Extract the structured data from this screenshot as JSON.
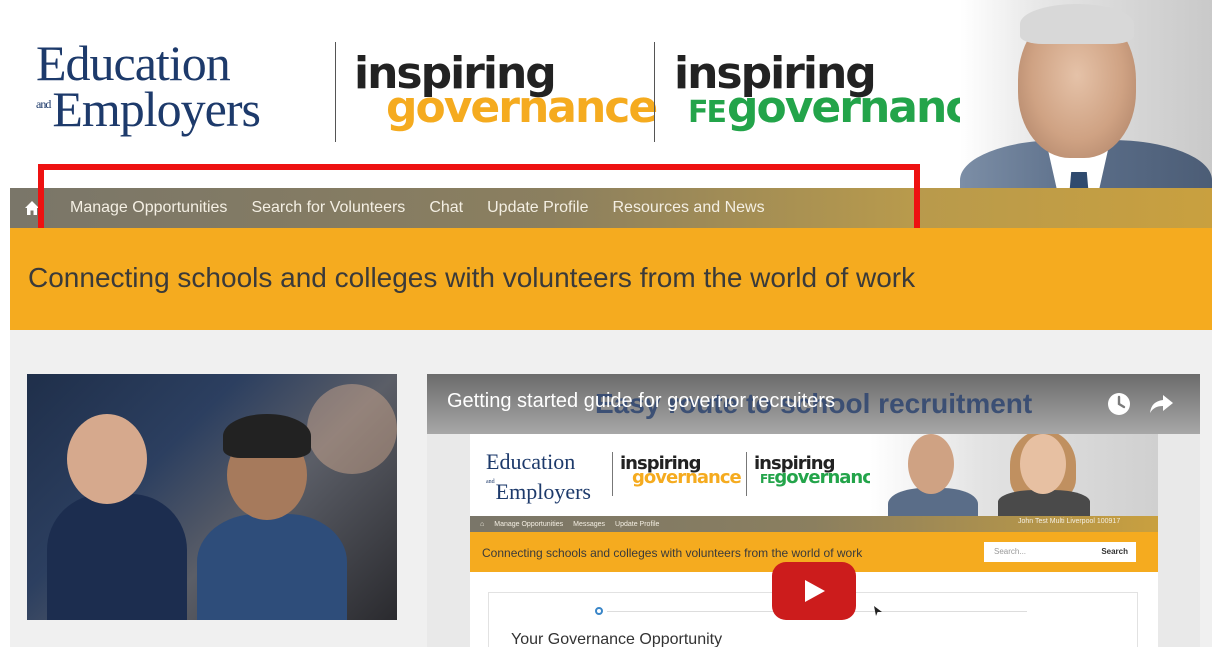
{
  "header": {
    "logo_education": "Education",
    "logo_and": "and",
    "logo_employers": "Employers",
    "logo_inspiring": "inspiring",
    "logo_governance": "governance",
    "logo_inspiring_fe": "inspiring",
    "logo_fe": "FE",
    "logo_fe_governance": "governance"
  },
  "nav": {
    "home_icon": "home-icon",
    "items": [
      {
        "label": "Manage Opportunities"
      },
      {
        "label": "Search for Volunteers"
      },
      {
        "label": "Chat"
      },
      {
        "label": "Update Profile"
      },
      {
        "label": "Resources and News"
      }
    ]
  },
  "banner": {
    "tagline": "Connecting schools and colleges with volunteers from the world of work"
  },
  "video": {
    "title": "Getting started guide for governor recruiters",
    "background_title": "Easy route to school recruitment",
    "icons": [
      "clock-icon",
      "share-icon",
      "play-icon"
    ],
    "inner": {
      "logo_education": "Education",
      "logo_and": "and",
      "logo_employers": "Employers",
      "logo_inspiring": "inspiring",
      "logo_governance": "governance",
      "logo_fe": "FE",
      "logo_fe_governance": "governance",
      "nav_items": [
        "Manage Opportunities",
        "Messages",
        "Update Profile"
      ],
      "user": "John Test Multi Liverpool 100917",
      "tagline": "Connecting schools and colleges with volunteers from the world of work",
      "search_placeholder": "Search...",
      "search_button": "Search",
      "card_title": "Your Governance Opportunity"
    }
  },
  "colors": {
    "brand_navy": "#1d3a6b",
    "brand_orange": "#f5ab1f",
    "brand_green": "#23a44a",
    "highlight_red": "#ee1111",
    "play_red": "#cc1c1c"
  }
}
